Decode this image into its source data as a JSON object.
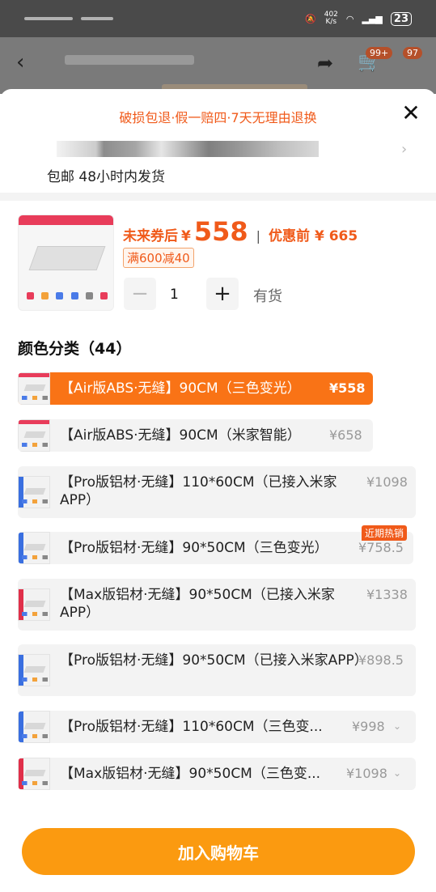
{
  "status_bar": {
    "speed_top": "402",
    "speed_unit": "K/s",
    "battery": "23"
  },
  "background_page": {
    "cart_badge": "99+",
    "messages_badge": "97"
  },
  "sheet": {
    "guarantee": "破损包退·假一赔四·7天无理由退换",
    "shipping": "包邮 48小时内发货",
    "price_label": "未来券后",
    "currency": "¥",
    "price": "558",
    "separator": "|",
    "before_price": "优惠前 ¥ 665",
    "coupon": "满600减40",
    "quantity": "1",
    "stock": "有货",
    "section_title": "颜色分类（44）",
    "hot_badge": "近期热销",
    "add_to_cart": "加入购物车"
  },
  "options": [
    {
      "label": "【Air版ABS·无缝】90CM（三色变光）",
      "price": "¥558"
    },
    {
      "label": "【Air版ABS·无缝】90CM（米家智能）",
      "price": "¥658"
    },
    {
      "label": "【Pro版铝材·无缝】110*60CM（已接入米家APP）",
      "price": "¥1098"
    },
    {
      "label": "【Pro版铝材·无缝】90*50CM（三色变光）",
      "price": "¥758.5"
    },
    {
      "label": "【Max版铝材·无缝】90*50CM（已接入米家APP）",
      "price": "¥1338"
    },
    {
      "label": "【Pro版铝材·无缝】90*50CM（已接入米家APP）",
      "price": "¥898.5"
    },
    {
      "label": "【Pro版铝材·无缝】110*60CM（三色变...",
      "price": "¥998"
    },
    {
      "label": "【Max版铝材·无缝】90*50CM（三色变...",
      "price": "¥1098"
    }
  ]
}
